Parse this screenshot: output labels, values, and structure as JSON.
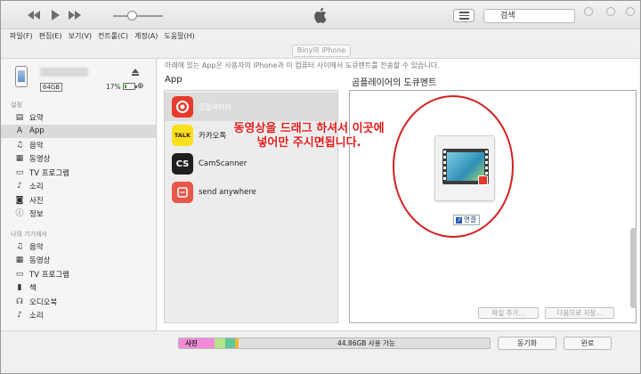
{
  "menu": [
    "파일(F)",
    "편집(E)",
    "보기(V)",
    "컨트롤(C)",
    "계정(A)",
    "도움말(H)"
  ],
  "device_tab": "Biny의 iPhone",
  "search": {
    "value": "검색"
  },
  "device": {
    "capacity": "64GB",
    "battery": "17%",
    "battery_level": 0.17
  },
  "sidebar": {
    "settings_header": "설정",
    "settings_items": [
      {
        "label": "요약",
        "icon": "summary-icon"
      },
      {
        "label": "App",
        "icon": "app-store-icon"
      },
      {
        "label": "음악",
        "icon": "music-note-icon"
      },
      {
        "label": "동영상",
        "icon": "film-icon"
      },
      {
        "label": "TV 프로그램",
        "icon": "tv-icon"
      },
      {
        "label": "소리",
        "icon": "bell-icon"
      },
      {
        "label": "사진",
        "icon": "camera-icon"
      },
      {
        "label": "정보",
        "icon": "info-icon"
      }
    ],
    "device_header": "나의 기기에서",
    "device_items": [
      {
        "label": "음악",
        "icon": "music-note-icon"
      },
      {
        "label": "동영상",
        "icon": "film-icon"
      },
      {
        "label": "TV 프로그램",
        "icon": "tv-icon"
      },
      {
        "label": "책",
        "icon": "book-icon"
      },
      {
        "label": "오디오북",
        "icon": "audiobook-icon"
      },
      {
        "label": "소리",
        "icon": "bell-icon"
      }
    ]
  },
  "main": {
    "hint": "아래에 있는 App은 사용자의 iPhone과 이 컴퓨터 사이에서 도큐멘트를 전송할 수 있습니다.",
    "apps_header": "App",
    "documents_header": "곰플레이어의 도큐멘트",
    "apps": [
      {
        "name": "곰플레이어",
        "icon": "gom-player-icon"
      },
      {
        "name": "카카오톡",
        "icon": "kakaotalk-icon",
        "icon_text": "TALK"
      },
      {
        "name": "CamScanner",
        "icon": "camscanner-icon",
        "icon_text": "CS"
      },
      {
        "name": "send anywhere",
        "icon": "send-anywhere-icon"
      }
    ],
    "drag_link_label": "연결",
    "annotation_line1": "동영상을 드래그 하셔서 이곳에",
    "annotation_line2": "넣어만 주시면됩니다.",
    "add_file_button": "파일 추가...",
    "save_to_button": "다음으로 저장..."
  },
  "capacity_bar": {
    "photo_label": "사진",
    "free_label": "44.86GB 사용 가능",
    "segments": [
      {
        "name": "사진",
        "color": "#f28ad8",
        "fraction": 0.115
      },
      {
        "name": "",
        "color": "#b4e388",
        "fraction": 0.035
      },
      {
        "name": "",
        "color": "#5fc79a",
        "fraction": 0.03
      },
      {
        "name": "",
        "color": "#f3b632",
        "fraction": 0.012
      }
    ]
  },
  "sync_button": "동기화",
  "done_button": "완료",
  "colors": {
    "annotation": "#e01a1a",
    "circle": "#d42020"
  }
}
